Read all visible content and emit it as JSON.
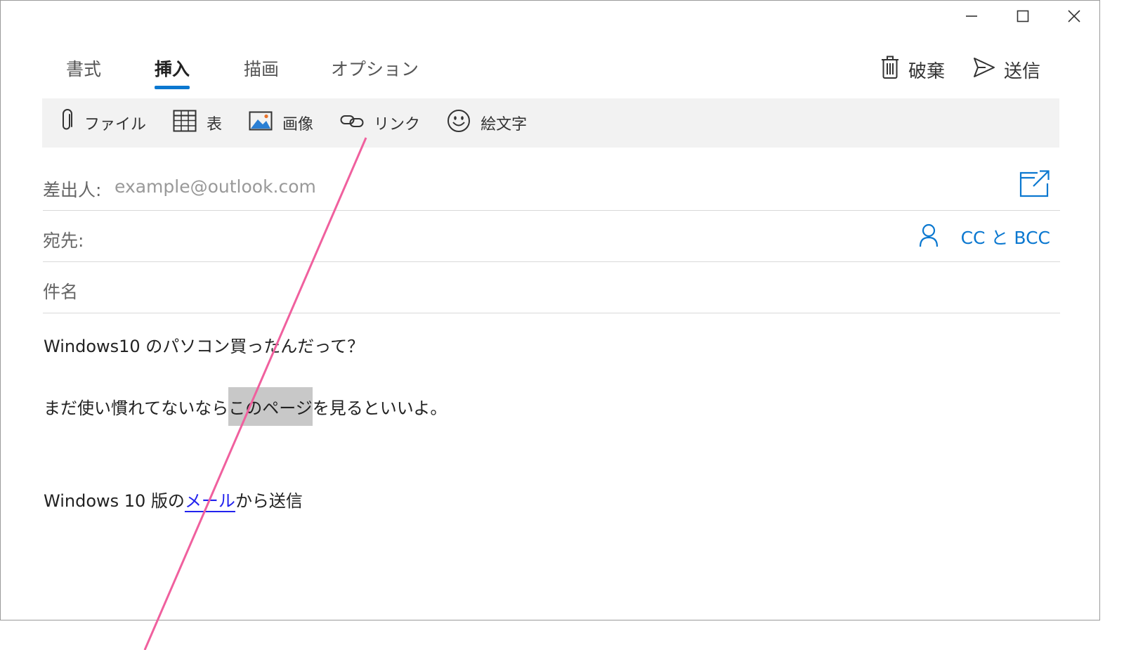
{
  "window_controls": {
    "minimize": "minimize",
    "maximize": "maximize",
    "close": "close"
  },
  "tabs": [
    {
      "label": "書式",
      "active": false
    },
    {
      "label": "挿入",
      "active": true
    },
    {
      "label": "描画",
      "active": false
    },
    {
      "label": "オプション",
      "active": false
    }
  ],
  "actions": {
    "discard_label": "破棄",
    "send_label": "送信"
  },
  "ribbon": {
    "items": [
      {
        "label": "ファイル",
        "icon": "paperclip-icon"
      },
      {
        "label": "表",
        "icon": "table-icon"
      },
      {
        "label": "画像",
        "icon": "image-icon"
      },
      {
        "label": "リンク",
        "icon": "link-icon"
      },
      {
        "label": "絵文字",
        "icon": "emoji-icon"
      }
    ]
  },
  "from": {
    "label": "差出人:",
    "value": "example@outlook.com"
  },
  "to": {
    "label": "宛先:",
    "cc_bcc_label": "CC と BCC"
  },
  "subject": {
    "placeholder": "件名"
  },
  "body": {
    "line1": "Windows10 のパソコン買ったんだって？",
    "line2_before": "まだ使い慣れてないなら",
    "line2_selected": "このページ",
    "line2_after": "を見るといいよ。",
    "signature_before": "Windows 10 版の",
    "signature_link": "メール",
    "signature_after": "から送信"
  },
  "colors": {
    "accent": "#0b78d0",
    "annotation_line": "#f0609e",
    "selection": "#c8c8c8",
    "link": "#2222ee"
  }
}
